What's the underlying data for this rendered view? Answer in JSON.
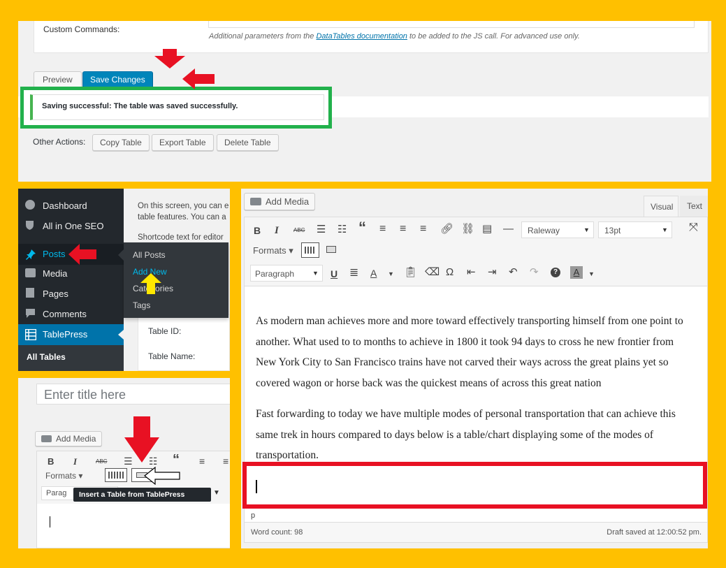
{
  "top": {
    "custom_commands_label": "Custom Commands:",
    "help_prefix": "Additional parameters from the ",
    "help_link": "DataTables documentation",
    "help_suffix": " to be added to the JS call. For advanced use only.",
    "preview_label": "Preview",
    "save_label": "Save Changes",
    "notice": "Saving successful: The table was saved successfully.",
    "other_actions_label": "Other Actions:",
    "copy_label": "Copy Table",
    "export_label": "Export Table",
    "delete_label": "Delete Table"
  },
  "sidebar": {
    "items": [
      {
        "label": "Dashboard",
        "icon": "dashboard-icon"
      },
      {
        "label": "All in One SEO",
        "icon": "shield-icon"
      },
      {
        "label": "Posts",
        "icon": "pin-icon"
      },
      {
        "label": "Media",
        "icon": "media-icon"
      },
      {
        "label": "Pages",
        "icon": "pages-icon"
      },
      {
        "label": "Comments",
        "icon": "comments-icon"
      },
      {
        "label": "TablePress",
        "icon": "table-icon"
      }
    ],
    "sub_current": "All Tables",
    "flyout": [
      "All Posts",
      "Add New",
      "Categories",
      "Tags"
    ],
    "content_line1": "On this screen, you can e",
    "content_line2": "table features. You can a",
    "content_line3": "Shortcode text for editor",
    "table_id_label": "Table ID:",
    "table_name_label": "Table Name:"
  },
  "small_editor": {
    "title_placeholder": "Enter title here",
    "add_media": "Add Media",
    "formats": "Formats",
    "paragraph": "Parag",
    "tooltip": "Insert a Table from TablePress"
  },
  "editor": {
    "add_media": "Add Media",
    "tab_visual": "Visual",
    "tab_text": "Text",
    "font_family": "Raleway",
    "font_size": "13pt",
    "formats": "Formats",
    "paragraph": "Paragraph",
    "paragraph1": [
      "As modern man achieves more and more toward effectively transporting himself from one point to",
      "another.  What used to to months to achieve in 1800 it took 94 days to cross he new frontier from",
      "New York City to San Francisco trains have not carved their ways across the great plains yet so",
      "covered wagon or horse back was the quickest means of across this great nation"
    ],
    "paragraph2": [
      "Fast forwarding to today we have multiple modes of personal transportation that can achieve this",
      "same trek in hours compared to days below is a table/chart displaying some of the modes of",
      "transportation."
    ],
    "path": "p",
    "word_count": "Word count: 98",
    "draft_saved": "Draft saved at 12:00:52 pm."
  },
  "colors": {
    "background": "#ffc000",
    "wp_admin_bar": "#23282d",
    "wp_blue": "#0073aa",
    "highlight_green": "#22b14c",
    "highlight_red": "#e81123",
    "arrow_red": "#e81123",
    "arrow_yellow": "#ffe800"
  }
}
